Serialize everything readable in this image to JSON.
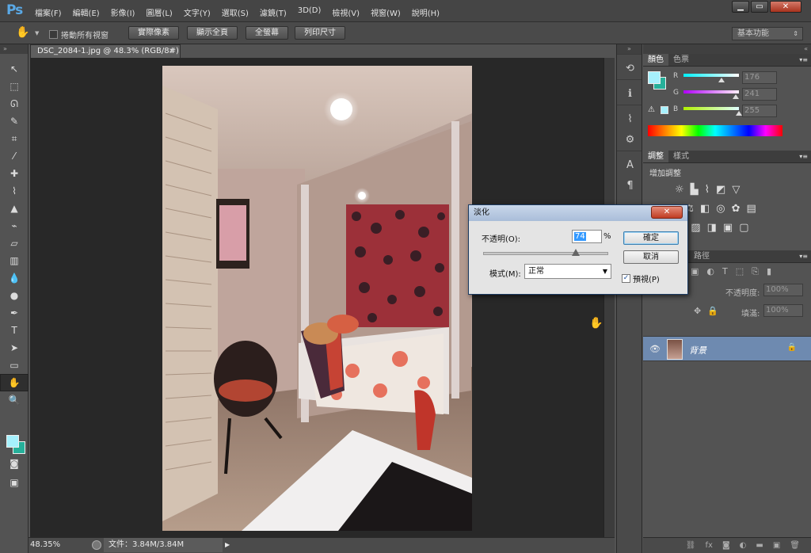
{
  "app": {
    "logo": "Ps"
  },
  "menubar": {
    "items": [
      "檔案(F)",
      "編輯(E)",
      "影像(I)",
      "圖層(L)",
      "文字(Y)",
      "選取(S)",
      "濾鏡(T)",
      "3D(D)",
      "檢視(V)",
      "視窗(W)",
      "說明(H)"
    ],
    "window_buttons": [
      "▁",
      "▭",
      "✕"
    ]
  },
  "options": {
    "scroll_all_label": "捲動所有視窗",
    "buttons": [
      "實際像素",
      "顯示全頁",
      "全螢幕",
      "列印尺寸"
    ],
    "workspace": "基本功能"
  },
  "document": {
    "tab_title": "DSC_2084-1.jpg @ 48.3% (RGB/8#) *",
    "tab_close": "×",
    "zoom": "48.35%",
    "doc_size": "文件：3.84M/3.84M"
  },
  "colors": {
    "foreground": "#a6f1fd",
    "background": "#26b09a",
    "accent_selected_layer": "#6e8ab0"
  },
  "color_panel": {
    "tabs": [
      "顏色",
      "色票"
    ],
    "r_label": "R",
    "g_label": "G",
    "b_label": "B",
    "r": "176",
    "g": "241",
    "b": "255",
    "r_level": 0.69,
    "g_level": 0.945,
    "b_level": 1.0
  },
  "adjust_panel": {
    "tabs": [
      "調整",
      "樣式"
    ],
    "title": "增加調整"
  },
  "layers_panel": {
    "tab_paths": "路徑",
    "opacity_label": "不透明度:",
    "opacity_value": "100%",
    "fill_label": "填滿:",
    "fill_value": "100%",
    "layer_name": "背景"
  },
  "fade_dialog": {
    "title": "淡化",
    "close": "✕",
    "opacity_label": "不透明(O):",
    "opacity_value": "74",
    "percent": "%",
    "opacity_level": 0.74,
    "mode_label": "模式(M):",
    "mode_value": "正常",
    "ok": "確定",
    "cancel": "取消",
    "preview_label": "預視(P)",
    "preview_checked": "✓"
  }
}
